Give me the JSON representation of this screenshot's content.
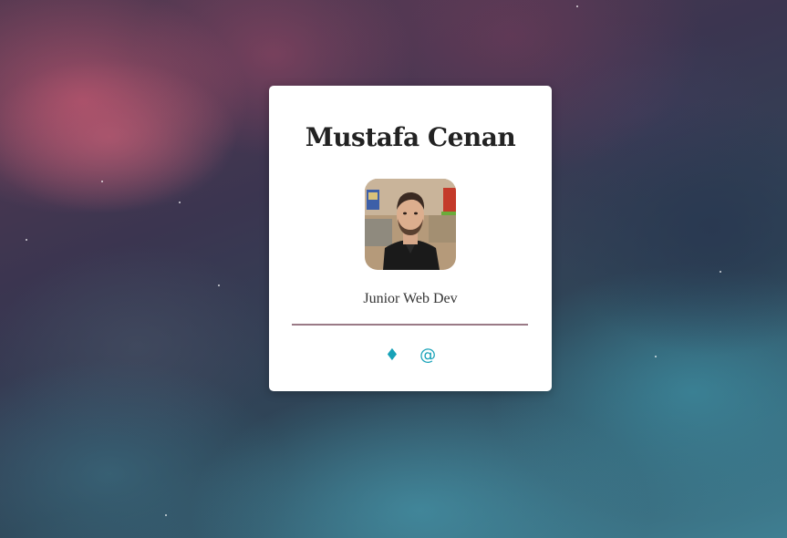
{
  "profile": {
    "name": "Mustafa Cenan",
    "role": "Junior Web Dev",
    "avatar": "profile-photo"
  },
  "links": [
    {
      "icon": "diamond-icon",
      "glyph": "♦"
    },
    {
      "icon": "at-icon",
      "glyph": "@"
    }
  ],
  "colors": {
    "card": "#ffffff",
    "divider": "#9a7a86",
    "link": "#17a2b8",
    "text": "#222222"
  }
}
